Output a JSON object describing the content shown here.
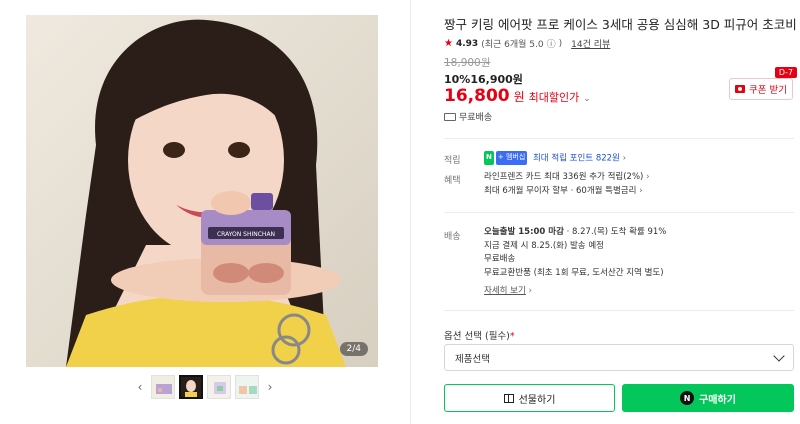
{
  "gallery": {
    "page_indicator": "2/4",
    "prev_icon": "chevron-left-icon",
    "next_icon": "chevron-right-icon",
    "product_label": "CRAYON SHINCHAN"
  },
  "product": {
    "title": "짱구 키링 에어팟 프로 케이스 3세대 공용 심심해 3D 피규어 초코비",
    "rating": "4.93",
    "rating_period": "(최근 6개월 5.0",
    "rating_info_icon": "ⓘ",
    "rating_close": ")",
    "review_count": "14건 리뷰",
    "original_price": "18,900원",
    "sale_rate": "10%",
    "sale_price": "16,900원",
    "max_discount_price": "16,800",
    "max_discount_unit": "원",
    "max_discount_label": "최대할인가",
    "coupon_label": "쿠폰 받기",
    "coupon_dday": "D-7",
    "shipping_free": "무료배송"
  },
  "benefits": {
    "points_label": "적립",
    "points_n": "N",
    "points_plus": "+ 멤버십",
    "points_text": "최대 적립 포인트 822원",
    "benefit_label": "혜택",
    "benefit_line1": "라인프렌즈 카드 최대 336원 추가 적립(2%)",
    "benefit_line2": "최대 6개월 무이자 할부 · 60개월 특별금리"
  },
  "delivery": {
    "label": "배송",
    "today_bold": "오늘출발 15:00 마감",
    "today_rest": " · 8.27.(목) 도착 확률 91%",
    "line2": "지금 결제 시 8.25.(화) 발송 예정",
    "line3": "무료배송",
    "line4": "무료교환반품 (최초 1회 무료, 도서산간 지역 별도)",
    "more_link": "자세히 보기"
  },
  "options": {
    "label": "옵션 선택 (필수)",
    "required_mark": "*",
    "placeholder": "제품선택"
  },
  "actions": {
    "gift_label": "선물하기",
    "buy_label": "구매하기"
  },
  "colors": {
    "accent_red": "#e60012",
    "naver_green": "#03c75a"
  }
}
